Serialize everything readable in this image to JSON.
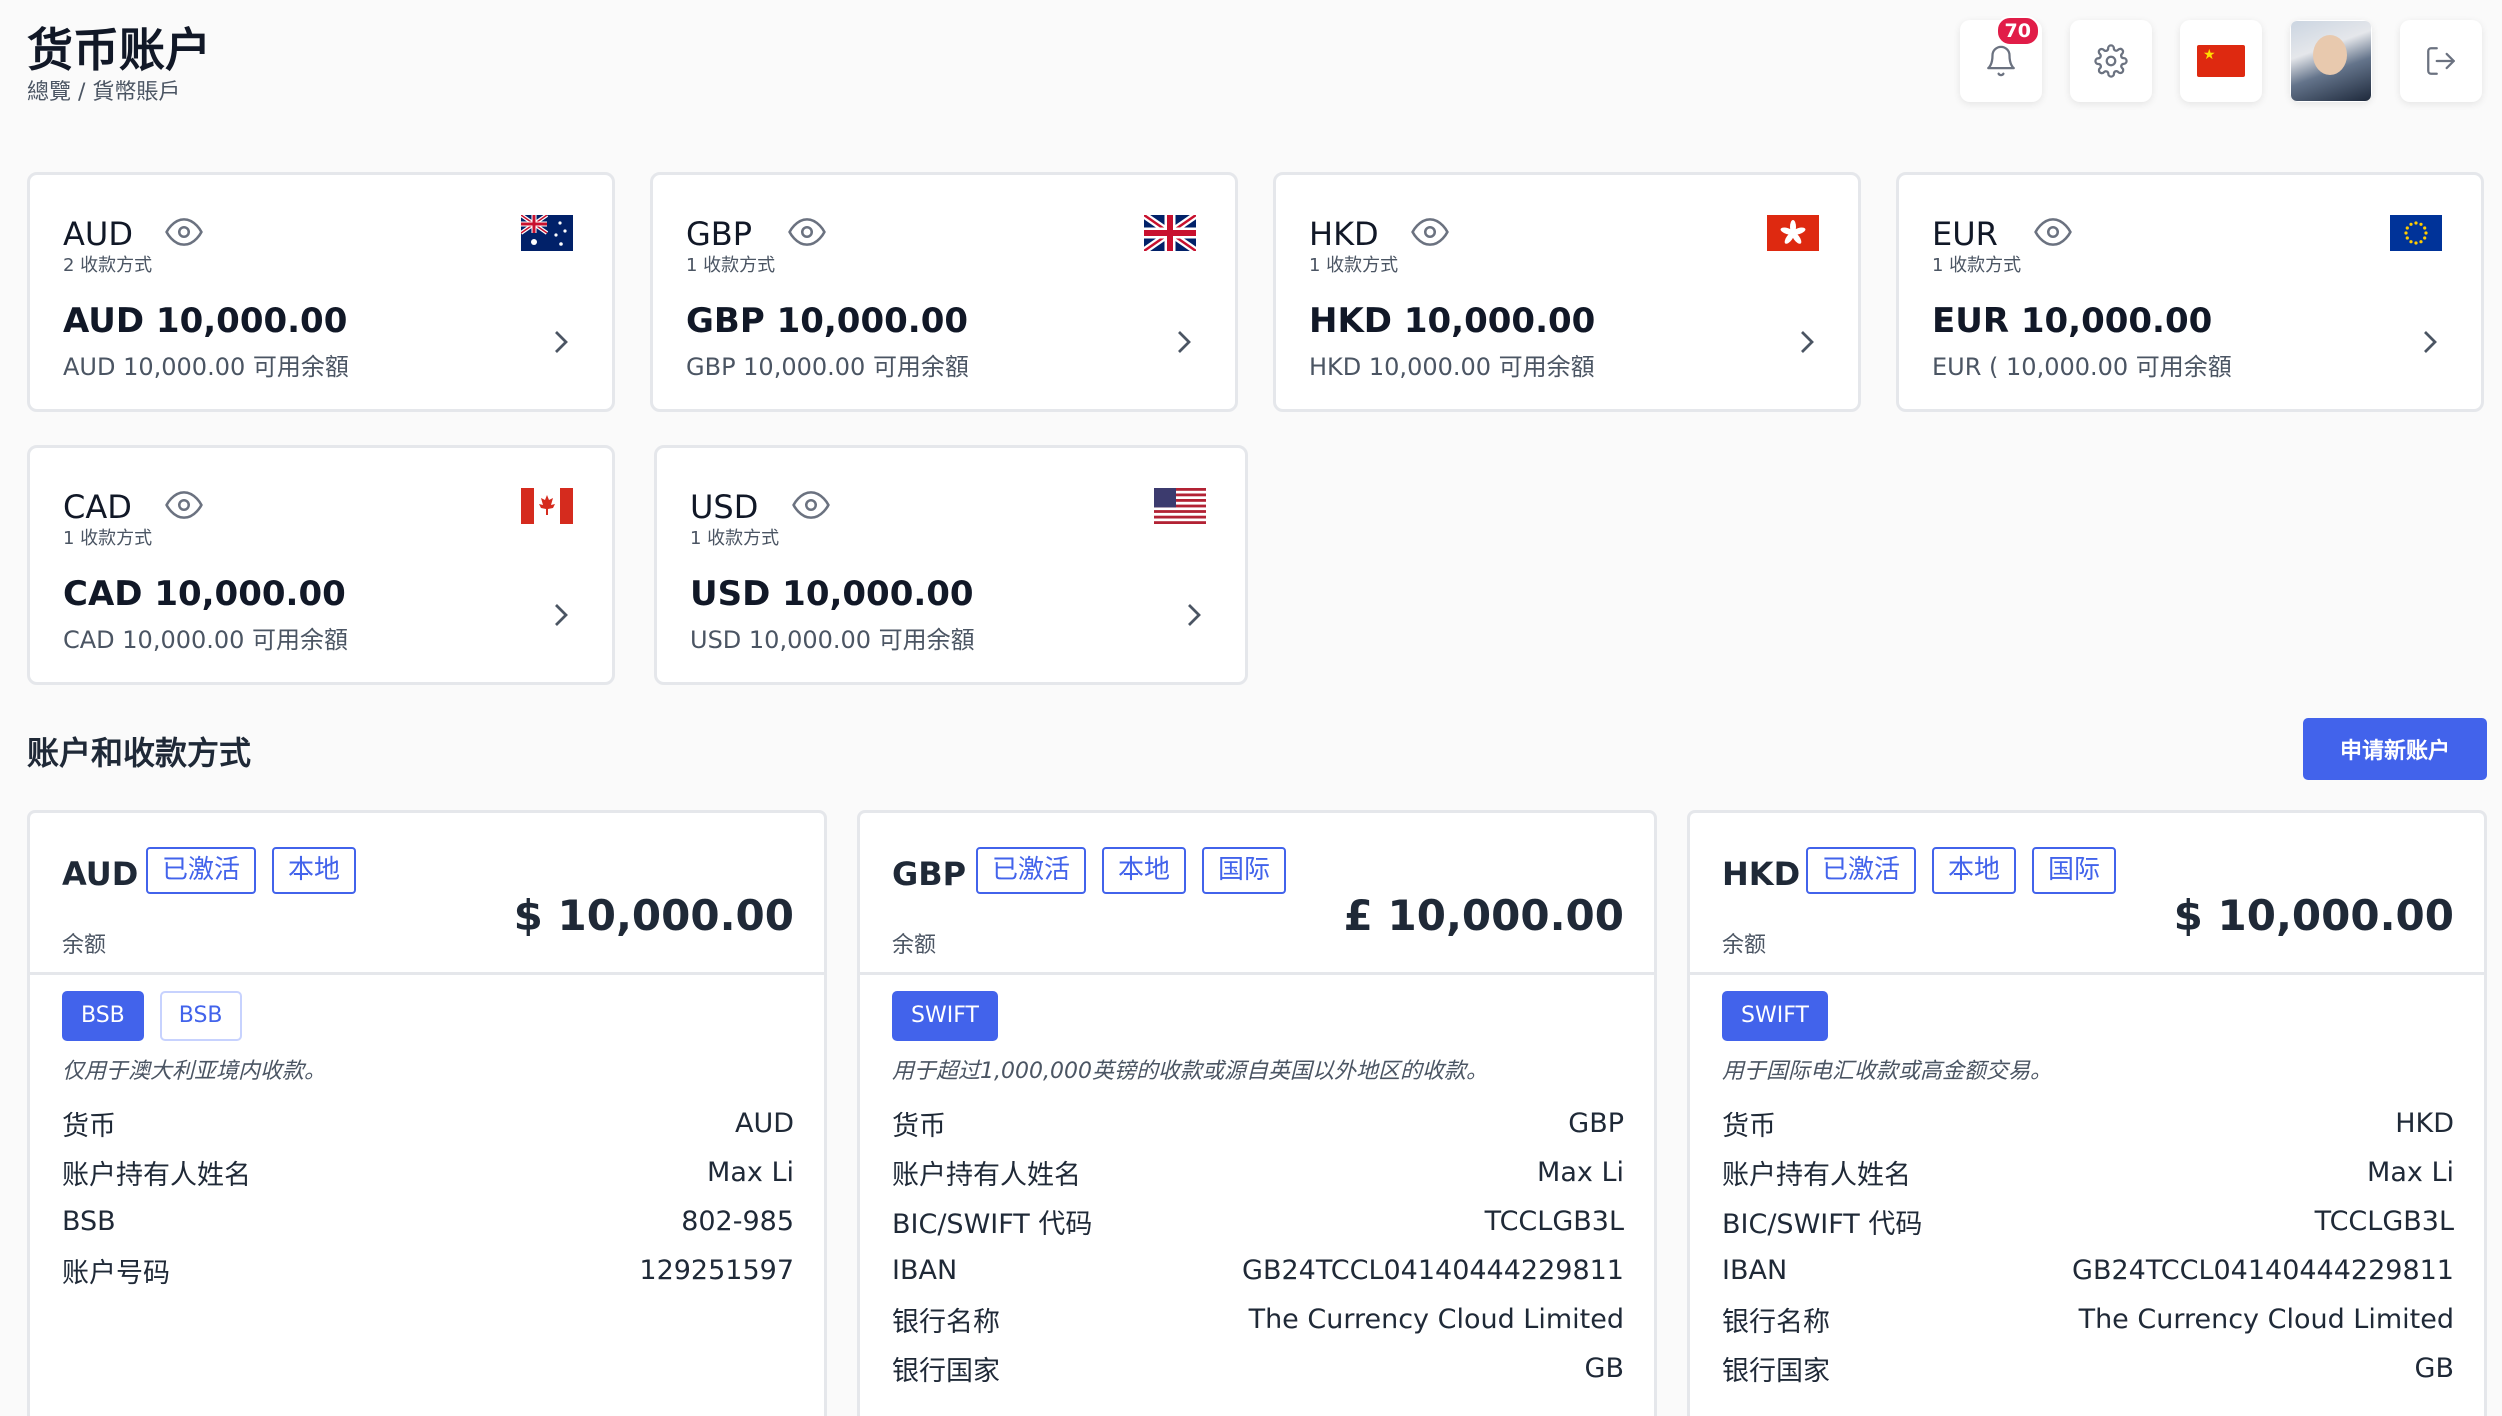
{
  "header": {
    "title": "货币账户",
    "breadcrumb": "總覽 / 貨幣賬戶",
    "notification_count": "70"
  },
  "currencies": [
    {
      "code": "AUD",
      "methods": "2 收款方式",
      "balance": "AUD 10,000.00",
      "available": "AUD  10,000.00 可用余額"
    },
    {
      "code": "GBP",
      "methods": "1 收款方式",
      "balance": "GBP 10,000.00",
      "available": "GBP 10,000.00 可用余額"
    },
    {
      "code": "HKD",
      "methods": "1 收款方式",
      "balance": "HKD 10,000.00",
      "available": "HKD  10,000.00 可用余額"
    },
    {
      "code": "EUR",
      "methods": "1 收款方式",
      "balance": "EUR  10,000.00",
      "available": "EUR ( 10,000.00 可用余額"
    },
    {
      "code": "CAD",
      "methods": "1 收款方式",
      "balance": "CAD  10,000.00",
      "available": "CAD  10,000.00 可用余額"
    },
    {
      "code": "USD",
      "methods": "1 收款方式",
      "balance": "USD 10,000.00",
      "available": "USD  10,000.00 可用余額"
    }
  ],
  "section": {
    "title": "账户和收款方式",
    "apply_label": "申请新账户"
  },
  "accounts": [
    {
      "code": "AUD",
      "tags": [
        "已激活",
        "本地"
      ],
      "balance_label": "余额",
      "balance": "$ 10,000.00",
      "methods": [
        "BSB",
        "BSB"
      ],
      "description": "仅用于澳大利亚境内收款。",
      "rows": [
        {
          "k": "货币",
          "v": "AUD"
        },
        {
          "k": "账户持有人姓名",
          "v": "Max Li"
        },
        {
          "k": "BSB",
          "v": "802-985"
        },
        {
          "k": "账户号码",
          "v": "129251597"
        }
      ]
    },
    {
      "code": "GBP",
      "tags": [
        "已激活",
        "本地",
        "国际"
      ],
      "balance_label": "余额",
      "balance": "£ 10,000.00",
      "methods": [
        "SWIFT"
      ],
      "description": "用于超过1,000,000英镑的收款或源自英国以外地区的收款。",
      "rows": [
        {
          "k": "货币",
          "v": "GBP"
        },
        {
          "k": "账户持有人姓名",
          "v": "Max Li"
        },
        {
          "k": "BIC/SWIFT 代码",
          "v": "TCCLGB3L"
        },
        {
          "k": "IBAN",
          "v": "GB24TCCL04140444229811"
        },
        {
          "k": "银行名称",
          "v": "The Currency Cloud Limited"
        },
        {
          "k": "银行国家",
          "v": "GB"
        }
      ]
    },
    {
      "code": "HKD",
      "tags": [
        "已激活",
        "本地",
        "国际"
      ],
      "balance_label": "余额",
      "balance": "$ 10,000.00",
      "methods": [
        "SWIFT"
      ],
      "description": "用于国际电汇收款或高金额交易。",
      "rows": [
        {
          "k": "货币",
          "v": "HKD"
        },
        {
          "k": "账户持有人姓名",
          "v": "Max Li"
        },
        {
          "k": "BIC/SWIFT 代码",
          "v": "TCCLGB3L"
        },
        {
          "k": "IBAN",
          "v": "GB24TCCL04140444229811"
        },
        {
          "k": "银行名称",
          "v": "The Currency Cloud Limited"
        },
        {
          "k": "银行国家",
          "v": "GB"
        }
      ]
    }
  ],
  "colors": {
    "accent": "#4263eb",
    "badge": "#e11d48"
  },
  "icons": [
    "bell-icon",
    "gear-icon",
    "china-flag-icon",
    "logout-icon",
    "eye-icon",
    "chevron-right-icon"
  ]
}
